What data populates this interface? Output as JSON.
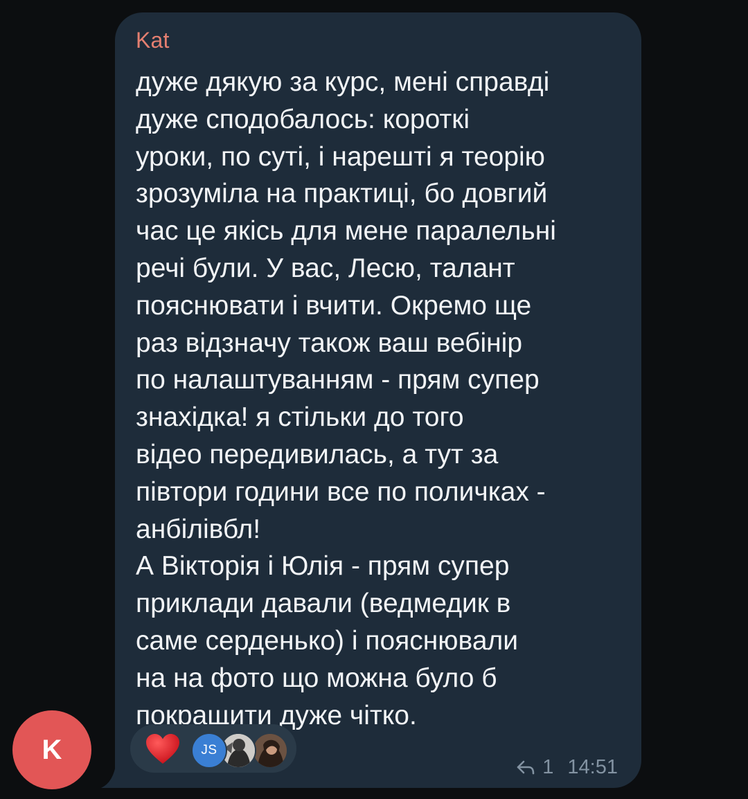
{
  "message": {
    "sender_name": "Kat",
    "sender_color": "#e47f70",
    "text": "дуже дякую за курс, мені справді\nдуже сподобалось: короткі\nуроки, по суті, і нарешті я теорію\nзрозуміла на практиці, бо довгий\nчас це якісь для мене паралельні\nречі були. У вас, Лесю, талант\nпояснювати і вчити. Окремо ще\nраз відзначу також ваш вебінір\nпо налаштуванням - прям супер\nзнахідка! я стільки до того\nвідео передивилась, а тут за\nпівтори години все по поличках -\nанбілівбл!\nА Вікторія і Юлія - прям супер\nприклади давали (ведмедик в\nсаме серденько) і пояснювали\nна на фото що можна було б\nпокращити дуже чітко.",
    "reply_count": "1",
    "time": "14:51",
    "bubble_color": "#1e2c3a"
  },
  "reactions": {
    "emoji_icon": "heart-icon",
    "reactor_initials": "JS"
  },
  "avatar": {
    "initial": "K",
    "color": "#e25656"
  }
}
